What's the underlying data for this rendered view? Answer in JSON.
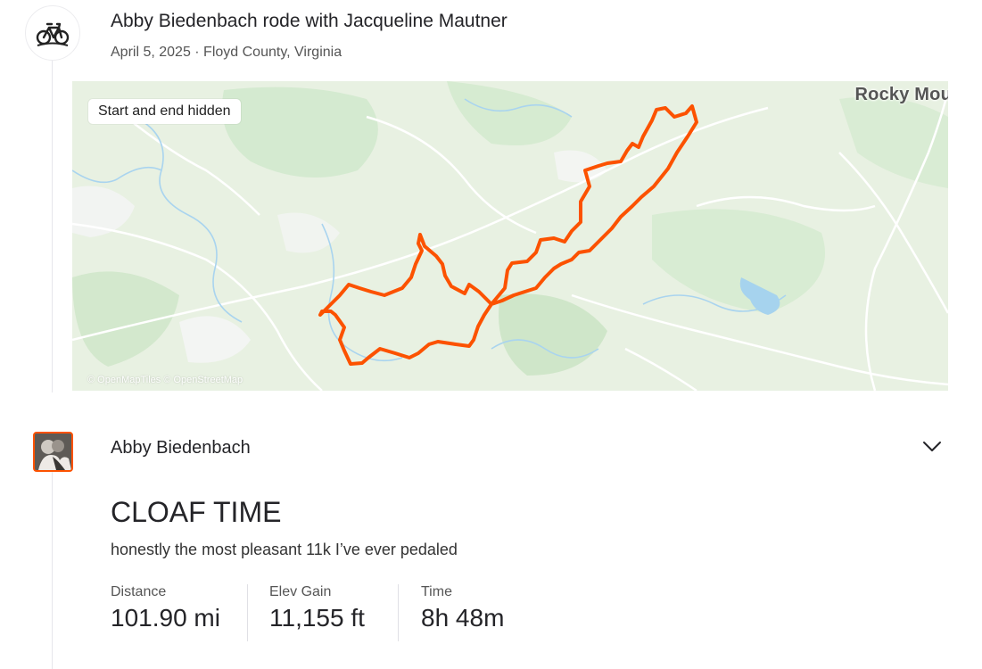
{
  "header": {
    "title": "Abby Biedenbach rode with Jacqueline Mautner",
    "subtitle": "April 5, 2025 · Floyd County, Virginia",
    "sport_icon": "bike-icon"
  },
  "map": {
    "badge": "Start and end hidden",
    "place_label": "Rocky Mou",
    "credit": "© OpenMapTiles © OpenStreetMap",
    "route_color": "#fc5200"
  },
  "athlete": {
    "name": "Abby Biedenbach",
    "expand_icon": "chevron-down-icon"
  },
  "activity": {
    "title": "CLOAF TIME",
    "description": "honestly the most pleasant 11k I’ve ever pedaled"
  },
  "stats": [
    {
      "label": "Distance",
      "value": "101.90 mi"
    },
    {
      "label": "Elev Gain",
      "value": "11,155 ft"
    },
    {
      "label": "Time",
      "value": "8h 48m"
    }
  ],
  "colors": {
    "accent": "#fc5200",
    "text": "#242428",
    "muted": "#555555"
  }
}
